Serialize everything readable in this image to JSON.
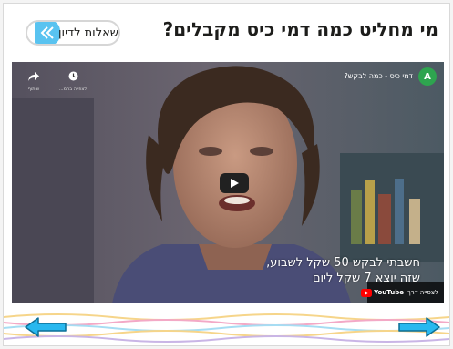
{
  "header": {
    "title": "מי מחליט כמה דמי כיס מקבלים?",
    "discuss_label": "שאלות לדיון"
  },
  "video": {
    "title": "דמי כיס - כמה לבקש?",
    "channel_initial": "A",
    "share_label": "שיתוף",
    "watch_later_label": "לצפייה בהמ...",
    "subtitle_line1": "חשבתי לבקש 50 שקל לשבוע,",
    "subtitle_line2": "שזה יוצא 7 שקל ליום",
    "watch_on_label": "לצפייה דרך",
    "watch_on_brand": "YouTube"
  },
  "icons": {
    "discuss": "double-chevron-left-icon",
    "share": "share-arrow-icon",
    "watch_later": "clock-icon",
    "play": "play-icon",
    "prev": "arrow-left-icon",
    "next": "arrow-right-icon"
  },
  "colors": {
    "accent": "#59c3f0",
    "nav_arrow": "#29b8ef",
    "youtube_red": "#ff0000"
  }
}
